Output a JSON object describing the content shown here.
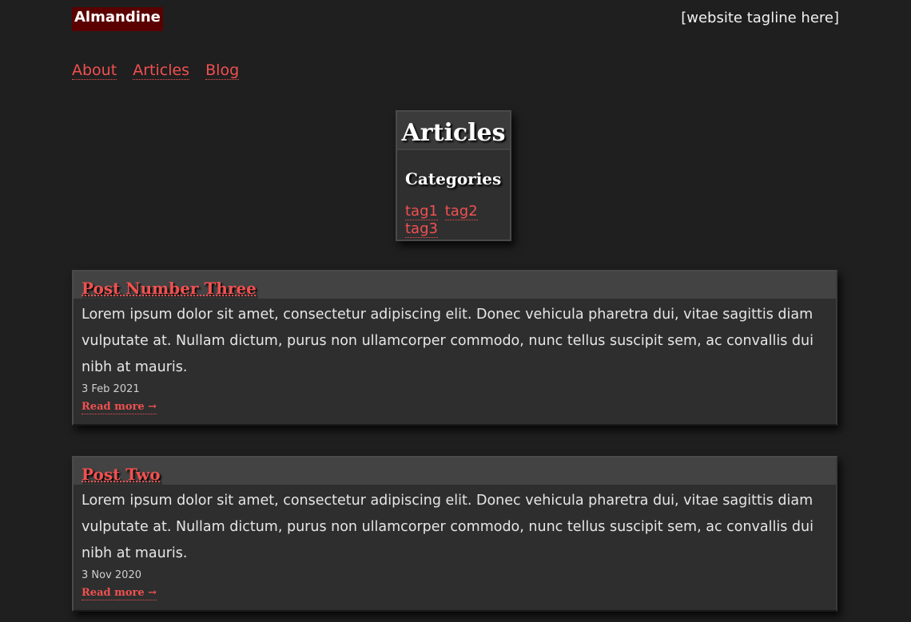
{
  "site": {
    "brand": "Almandine",
    "tagline": "[website tagline here]"
  },
  "nav": {
    "items": [
      {
        "label": "About"
      },
      {
        "label": "Articles"
      },
      {
        "label": "Blog"
      }
    ]
  },
  "articles_box": {
    "title": "Articles",
    "categories_heading": "Categories",
    "tags": [
      "tag1",
      "tag2",
      "tag3"
    ]
  },
  "posts": [
    {
      "title": "Post Number Three",
      "excerpt": "Lorem ipsum dolor sit amet, consectetur adipiscing elit. Donec vehicula pharetra dui, vitae sagittis diam vulputate at. Nullam dictum, purus non ullamcorper commodo, nunc tellus suscipit sem, ac convallis dui nibh at mauris.",
      "date": "3 Feb 2021",
      "read_more": "Read more →"
    },
    {
      "title": "Post Two",
      "excerpt": "Lorem ipsum dolor sit amet, consectetur adipiscing elit. Donec vehicula pharetra dui, vitae sagittis diam vulputate at. Nullam dictum, purus non ullamcorper commodo, nunc tellus suscipit sem, ac convallis dui nibh at mauris.",
      "date": "3 Nov 2020",
      "read_more": "Read more →"
    }
  ],
  "colors": {
    "background": "#1f1f1f",
    "accent_link": "#f15050",
    "brand_background": "#5a0000"
  }
}
